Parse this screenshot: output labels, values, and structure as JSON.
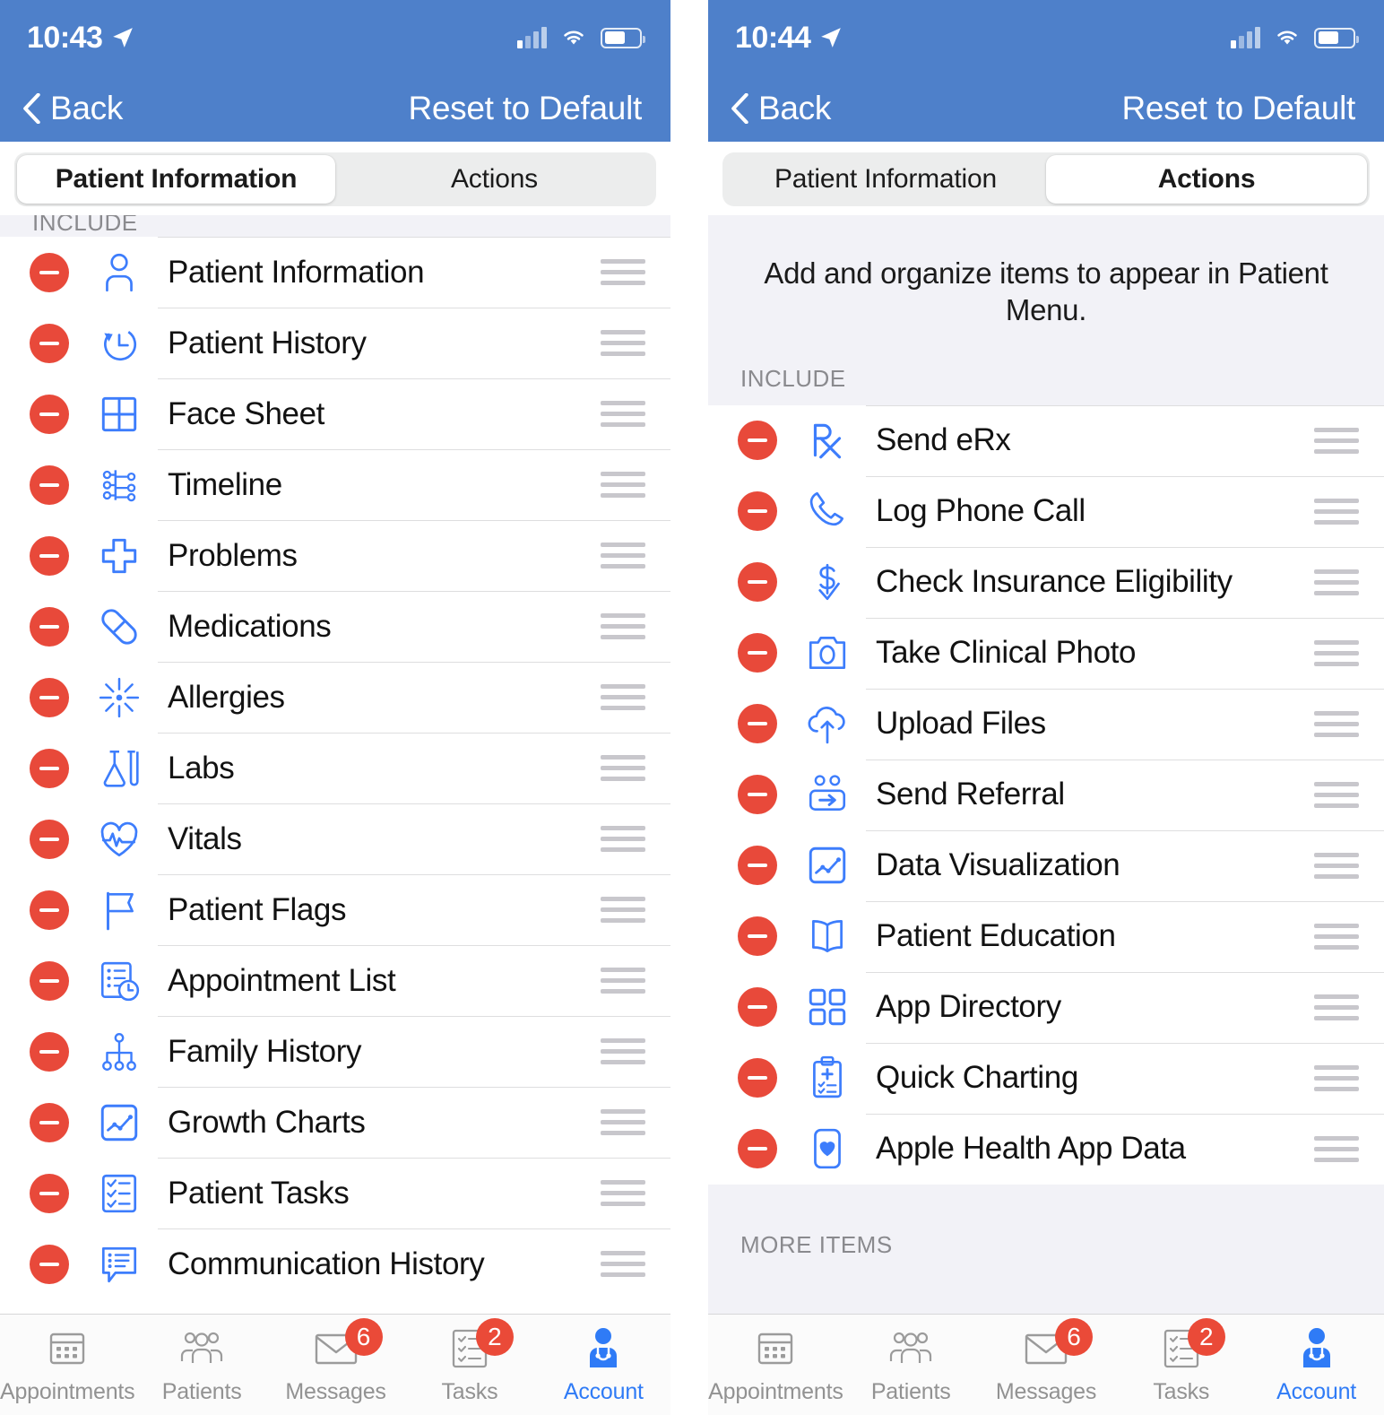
{
  "colors": {
    "header_blue": "#4e80ca",
    "icon_blue": "#3d7dfc",
    "delete_red": "#e8493a",
    "badge_red": "#ea4a38",
    "active_tab_blue": "#2f7bf6",
    "group_bg": "#f2f2f7"
  },
  "left": {
    "status": {
      "time": "10:43",
      "location_icon": "location-arrow-icon",
      "signal_icon": "cellular-signal-icon",
      "wifi_icon": "wifi-icon",
      "battery_icon": "battery-icon"
    },
    "nav": {
      "back_label": "Back",
      "back_icon": "chevron-left-icon",
      "action_label": "Reset to Default"
    },
    "segmented": {
      "options": [
        "Patient Information",
        "Actions"
      ],
      "selected": "Patient Information"
    },
    "section_header": "INCLUDE",
    "items": [
      {
        "label": "Patient Information",
        "icon": "person-icon"
      },
      {
        "label": "Patient History",
        "icon": "clock-rewind-icon"
      },
      {
        "label": "Face Sheet",
        "icon": "grid-four-icon"
      },
      {
        "label": "Timeline",
        "icon": "timeline-branch-icon"
      },
      {
        "label": "Problems",
        "icon": "medical-cross-icon"
      },
      {
        "label": "Medications",
        "icon": "pill-capsule-icon"
      },
      {
        "label": "Allergies",
        "icon": "allergy-burst-icon"
      },
      {
        "label": "Labs",
        "icon": "lab-flask-icon"
      },
      {
        "label": "Vitals",
        "icon": "heart-pulse-icon"
      },
      {
        "label": "Patient Flags",
        "icon": "flag-icon"
      },
      {
        "label": "Appointment List",
        "icon": "list-clock-icon"
      },
      {
        "label": "Family History",
        "icon": "family-tree-icon"
      },
      {
        "label": "Growth Charts",
        "icon": "line-chart-box-icon"
      },
      {
        "label": "Patient Tasks",
        "icon": "checklist-icon"
      },
      {
        "label": "Communication History",
        "icon": "chat-list-icon"
      }
    ]
  },
  "right": {
    "status": {
      "time": "10:44",
      "location_icon": "location-arrow-icon",
      "signal_icon": "cellular-signal-icon",
      "wifi_icon": "wifi-icon",
      "battery_icon": "battery-icon"
    },
    "nav": {
      "back_label": "Back",
      "back_icon": "chevron-left-icon",
      "action_label": "Reset to Default"
    },
    "segmented": {
      "options": [
        "Patient Information",
        "Actions"
      ],
      "selected": "Actions"
    },
    "intro_text": "Add and organize items to appear in Patient Menu.",
    "section_header": "INCLUDE",
    "more_header": "MORE ITEMS",
    "items": [
      {
        "label": "Send eRx",
        "icon": "rx-icon"
      },
      {
        "label": "Log Phone Call",
        "icon": "phone-icon"
      },
      {
        "label": "Check Insurance Eligibility",
        "icon": "dollar-check-icon"
      },
      {
        "label": "Take Clinical Photo",
        "icon": "camera-icon"
      },
      {
        "label": "Upload Files",
        "icon": "cloud-upload-icon"
      },
      {
        "label": "Send Referral",
        "icon": "referral-people-icon"
      },
      {
        "label": "Data Visualization",
        "icon": "line-chart-box-icon"
      },
      {
        "label": "Patient Education",
        "icon": "open-book-icon"
      },
      {
        "label": "App Directory",
        "icon": "grid-apps-icon"
      },
      {
        "label": "Quick Charting",
        "icon": "clipboard-plus-icon"
      },
      {
        "label": "Apple Health App Data",
        "icon": "heart-card-icon"
      }
    ]
  },
  "tabbar": {
    "tabs": [
      {
        "label": "Appointments",
        "icon": "calendar-icon",
        "badge": "",
        "active": false
      },
      {
        "label": "Patients",
        "icon": "people-icon",
        "badge": "",
        "active": false
      },
      {
        "label": "Messages",
        "icon": "envelope-icon",
        "badge": "6",
        "active": false
      },
      {
        "label": "Tasks",
        "icon": "checklist-icon",
        "badge": "2",
        "active": false
      },
      {
        "label": "Account",
        "icon": "doctor-icon",
        "badge": "",
        "active": true
      }
    ]
  }
}
